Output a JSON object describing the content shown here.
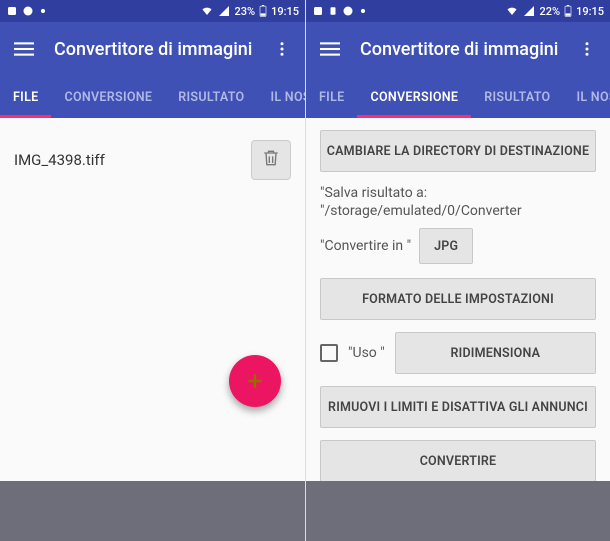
{
  "left": {
    "status": {
      "battery": "23%",
      "time": "19:15"
    },
    "app_title": "Convertitore di immagini",
    "tabs": [
      "FILE",
      "CONVERSIONE",
      "RISULTATO",
      "IL NOSTRO"
    ],
    "active_tab": 0,
    "file": {
      "name": "IMG_4398.tiff"
    }
  },
  "right": {
    "status": {
      "battery": "22%",
      "time": "19:15"
    },
    "app_title": "Convertitore di immagini",
    "tabs": [
      "FILE",
      "CONVERSIONE",
      "RISULTATO",
      "IL NOSTRO"
    ],
    "active_tab": 1,
    "buttons": {
      "change_dir": "CAMBIARE LA DIRECTORY DI DESTINAZIONE",
      "settings_format": "FORMATO DELLE IMPOSTAZIONI",
      "resize": "RIDIMENSIONA",
      "remove_limits": "RIMUOVI I LIMITI E DISATTIVA GLI ANNUNCI",
      "convert": "CONVERTIRE"
    },
    "save_path_text": "\"Salva risultato a: \"/storage/emulated/0/Converter",
    "convert_to_label": "\"Convertire in \"",
    "format_value": "JPG",
    "use_label": "\"Uso \""
  }
}
